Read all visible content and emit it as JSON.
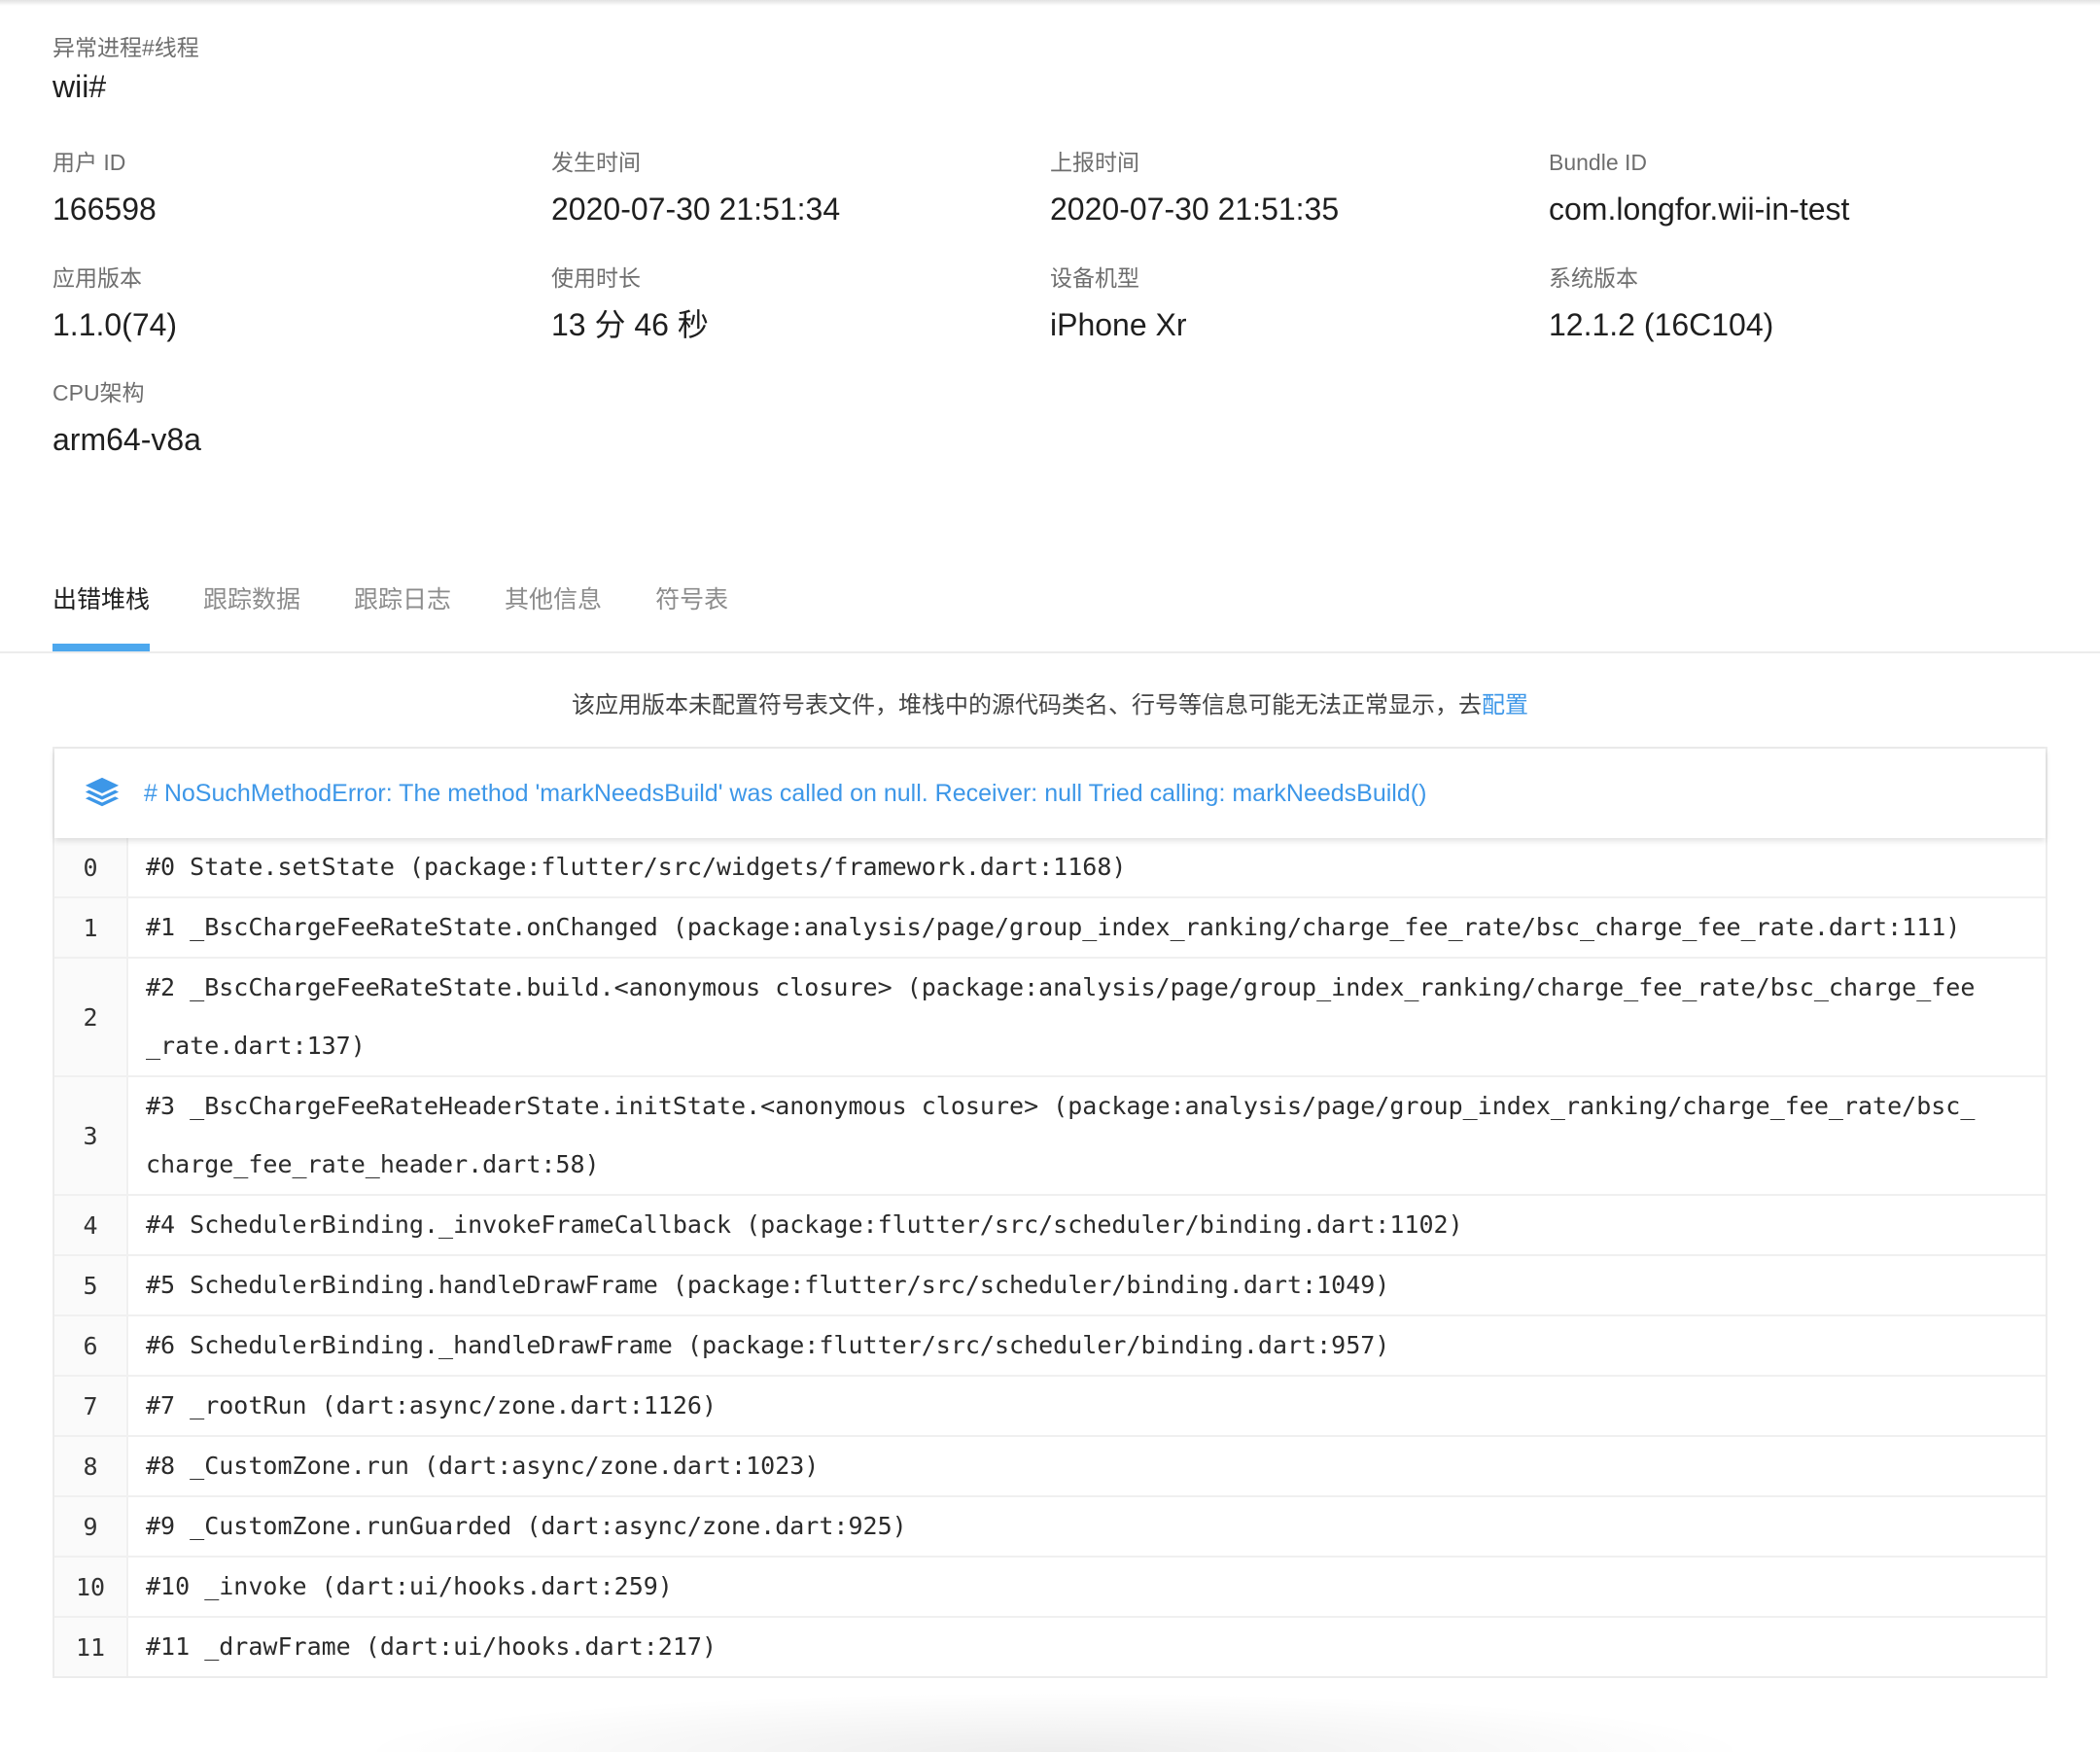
{
  "process": {
    "label": "异常进程#线程",
    "value": "wii#"
  },
  "fields": {
    "user_id": {
      "label": "用户 ID",
      "value": "166598"
    },
    "occur_time": {
      "label": "发生时间",
      "value": "2020-07-30 21:51:34"
    },
    "report_time": {
      "label": "上报时间",
      "value": "2020-07-30 21:51:35"
    },
    "bundle_id": {
      "label": "Bundle ID",
      "value": "com.longfor.wii-in-test"
    },
    "app_version": {
      "label": "应用版本",
      "value": "1.1.0(74)"
    },
    "duration": {
      "label": "使用时长",
      "value": "13 分 46 秒"
    },
    "device_model": {
      "label": "设备机型",
      "value": "iPhone Xr"
    },
    "os_version": {
      "label": "系统版本",
      "value": "12.1.2 (16C104)"
    },
    "cpu_arch": {
      "label": "CPU架构",
      "value": "arm64-v8a"
    }
  },
  "tabs": [
    {
      "label": "出错堆栈",
      "active": true
    },
    {
      "label": "跟踪数据",
      "active": false
    },
    {
      "label": "跟踪日志",
      "active": false
    },
    {
      "label": "其他信息",
      "active": false
    },
    {
      "label": "符号表",
      "active": false
    }
  ],
  "notice": {
    "text": "该应用版本未配置符号表文件，堆栈中的源代码类名、行号等信息可能无法正常显示，去",
    "link": "配置"
  },
  "colors": {
    "accent": "#3d97e8",
    "tab_indicator": "#4da8ee"
  },
  "stack": {
    "icon": "layers-icon",
    "title": "# NoSuchMethodError: The method 'markNeedsBuild' was called on null. Receiver: null Tried calling: markNeedsBuild()",
    "frames": [
      {
        "index": "0",
        "text": "#0 State.setState (package:flutter/src/widgets/framework.dart:1168)"
      },
      {
        "index": "1",
        "text": "#1 _BscChargeFeeRateState.onChanged (package:analysis/page/group_index_ranking/charge_fee_rate/bsc_charge_fee_rate.dart:111)"
      },
      {
        "index": "2",
        "text": "#2 _BscChargeFeeRateState.build.<anonymous closure> (package:analysis/page/group_index_ranking/charge_fee_rate/bsc_charge_fee_rate.dart:137)"
      },
      {
        "index": "3",
        "text": "#3 _BscChargeFeeRateHeaderState.initState.<anonymous closure> (package:analysis/page/group_index_ranking/charge_fee_rate/bsc_charge_fee_rate_header.dart:58)"
      },
      {
        "index": "4",
        "text": "#4 SchedulerBinding._invokeFrameCallback (package:flutter/src/scheduler/binding.dart:1102)"
      },
      {
        "index": "5",
        "text": "#5 SchedulerBinding.handleDrawFrame (package:flutter/src/scheduler/binding.dart:1049)"
      },
      {
        "index": "6",
        "text": "#6 SchedulerBinding._handleDrawFrame (package:flutter/src/scheduler/binding.dart:957)"
      },
      {
        "index": "7",
        "text": "#7 _rootRun (dart:async/zone.dart:1126)"
      },
      {
        "index": "8",
        "text": "#8 _CustomZone.run (dart:async/zone.dart:1023)"
      },
      {
        "index": "9",
        "text": "#9 _CustomZone.runGuarded (dart:async/zone.dart:925)"
      },
      {
        "index": "10",
        "text": "#10 _invoke (dart:ui/hooks.dart:259)"
      },
      {
        "index": "11",
        "text": "#11 _drawFrame (dart:ui/hooks.dart:217)"
      }
    ]
  }
}
